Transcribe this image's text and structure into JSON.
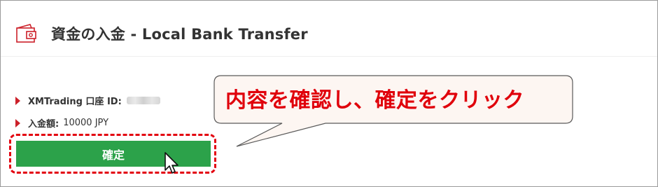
{
  "header": {
    "icon": "wallet-icon",
    "title": "資金の入金 - Local Bank Transfer"
  },
  "details": {
    "account_label": "XMTrading 口座 ID:",
    "amount_label": "入金額:",
    "amount_value": "10000 JPY"
  },
  "confirm_button": {
    "label": "確定"
  },
  "annotation": {
    "callout_text": "内容を確認し、確定をクリック"
  },
  "colors": {
    "accent_red": "#cc2029",
    "button_green": "#2ca24a",
    "callout_red": "#e0000b"
  }
}
